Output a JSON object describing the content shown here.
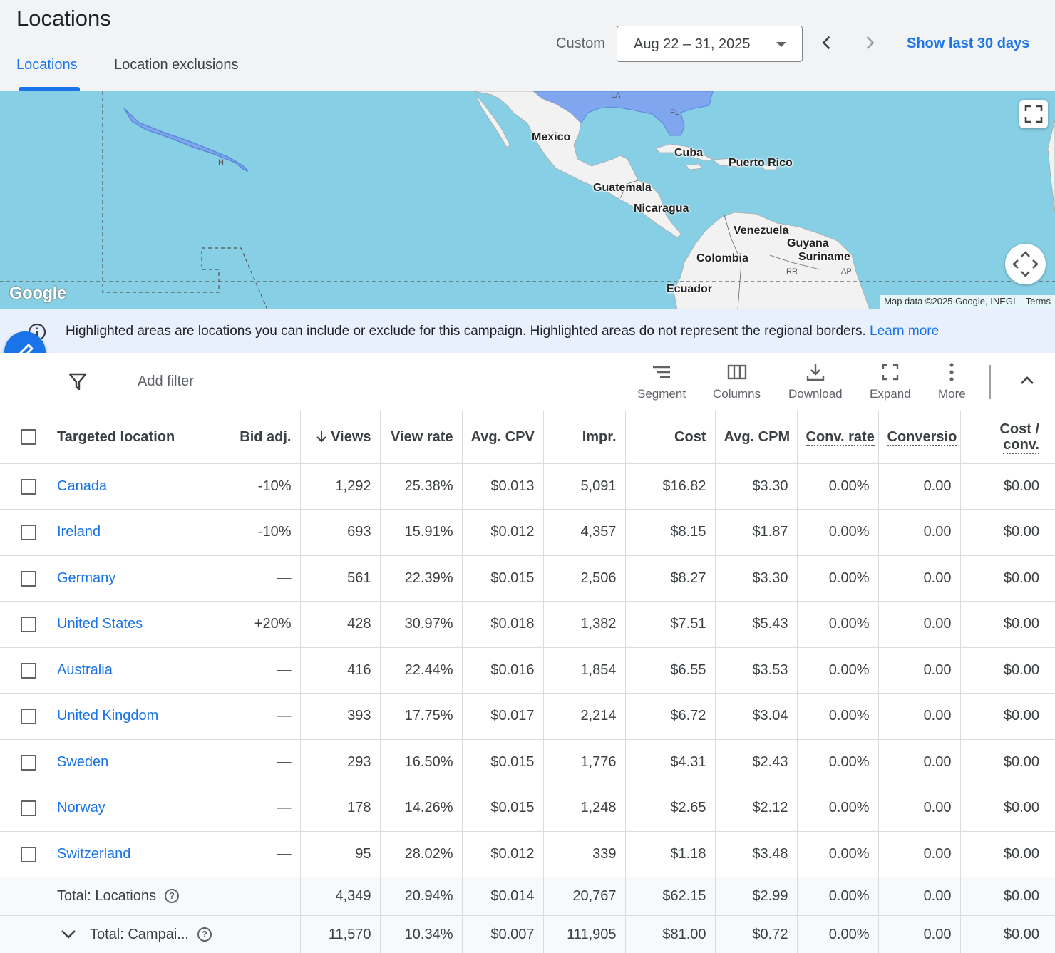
{
  "header": {
    "title": "Locations",
    "tabs": [
      {
        "label": "Locations"
      },
      {
        "label": "Location exclusions"
      }
    ],
    "custom_label": "Custom",
    "date_range": "Aug 22 – 31, 2025",
    "show_last": "Show last 30 days"
  },
  "map": {
    "labels": {
      "mexico": "Mexico",
      "cuba": "Cuba",
      "puerto_rico": "Puerto Rico",
      "guatemala": "Guatemala",
      "nicaragua": "Nicaragua",
      "venezuela": "Venezuela",
      "guyana": "Guyana",
      "suriname": "Suriname",
      "colombia": "Colombia",
      "ecuador": "Ecuador",
      "hi": "HI",
      "la": "LA",
      "fl": "FL",
      "rr": "RR",
      "ap": "AP"
    },
    "logo": "Google",
    "attribution": "Map data ©2025 Google, INEGI",
    "terms": "Terms"
  },
  "banner": {
    "text": "Highlighted areas are locations you can include or exclude for this campaign. Highlighted areas do not represent the regional borders.",
    "link": "Learn more"
  },
  "toolbar": {
    "add_filter": "Add filter",
    "segment": "Segment",
    "columns": "Columns",
    "download": "Download",
    "expand": "Expand",
    "more": "More"
  },
  "table": {
    "headers": {
      "location": "Targeted location",
      "bid_adj": "Bid adj.",
      "views": "Views",
      "view_rate": "View rate",
      "avg_cpv": "Avg. CPV",
      "impr": "Impr.",
      "cost": "Cost",
      "avg_cpm": "Avg. CPM",
      "conv_rate": "Conv. rate",
      "conversions": "Conversio",
      "cost_conv_1": "Cost /",
      "cost_conv_2": "conv."
    },
    "rows": [
      {
        "location": "Canada",
        "bid_adj": "-10%",
        "views": "1,292",
        "view_rate": "25.38%",
        "avg_cpv": "$0.013",
        "impr": "5,091",
        "cost": "$16.82",
        "avg_cpm": "$3.30",
        "conv_rate": "0.00%",
        "conversions": "0.00",
        "cost_conv": "$0.00"
      },
      {
        "location": "Ireland",
        "bid_adj": "-10%",
        "views": "693",
        "view_rate": "15.91%",
        "avg_cpv": "$0.012",
        "impr": "4,357",
        "cost": "$8.15",
        "avg_cpm": "$1.87",
        "conv_rate": "0.00%",
        "conversions": "0.00",
        "cost_conv": "$0.00"
      },
      {
        "location": "Germany",
        "bid_adj": "—",
        "views": "561",
        "view_rate": "22.39%",
        "avg_cpv": "$0.015",
        "impr": "2,506",
        "cost": "$8.27",
        "avg_cpm": "$3.30",
        "conv_rate": "0.00%",
        "conversions": "0.00",
        "cost_conv": "$0.00"
      },
      {
        "location": "United States",
        "bid_adj": "+20%",
        "views": "428",
        "view_rate": "30.97%",
        "avg_cpv": "$0.018",
        "impr": "1,382",
        "cost": "$7.51",
        "avg_cpm": "$5.43",
        "conv_rate": "0.00%",
        "conversions": "0.00",
        "cost_conv": "$0.00"
      },
      {
        "location": "Australia",
        "bid_adj": "—",
        "views": "416",
        "view_rate": "22.44%",
        "avg_cpv": "$0.016",
        "impr": "1,854",
        "cost": "$6.55",
        "avg_cpm": "$3.53",
        "conv_rate": "0.00%",
        "conversions": "0.00",
        "cost_conv": "$0.00"
      },
      {
        "location": "United Kingdom",
        "bid_adj": "—",
        "views": "393",
        "view_rate": "17.75%",
        "avg_cpv": "$0.017",
        "impr": "2,214",
        "cost": "$6.72",
        "avg_cpm": "$3.04",
        "conv_rate": "0.00%",
        "conversions": "0.00",
        "cost_conv": "$0.00"
      },
      {
        "location": "Sweden",
        "bid_adj": "—",
        "views": "293",
        "view_rate": "16.50%",
        "avg_cpv": "$0.015",
        "impr": "1,776",
        "cost": "$4.31",
        "avg_cpm": "$2.43",
        "conv_rate": "0.00%",
        "conversions": "0.00",
        "cost_conv": "$0.00"
      },
      {
        "location": "Norway",
        "bid_adj": "—",
        "views": "178",
        "view_rate": "14.26%",
        "avg_cpv": "$0.015",
        "impr": "1,248",
        "cost": "$2.65",
        "avg_cpm": "$2.12",
        "conv_rate": "0.00%",
        "conversions": "0.00",
        "cost_conv": "$0.00"
      },
      {
        "location": "Switzerland",
        "bid_adj": "—",
        "views": "95",
        "view_rate": "28.02%",
        "avg_cpv": "$0.012",
        "impr": "339",
        "cost": "$1.18",
        "avg_cpm": "$3.48",
        "conv_rate": "0.00%",
        "conversions": "0.00",
        "cost_conv": "$0.00"
      }
    ],
    "totals": [
      {
        "label": "Total: Locations",
        "bid_adj": "",
        "views": "4,349",
        "view_rate": "20.94%",
        "avg_cpv": "$0.014",
        "impr": "20,767",
        "cost": "$62.15",
        "avg_cpm": "$2.99",
        "conv_rate": "0.00%",
        "conversions": "0.00",
        "cost_conv": "$0.00"
      },
      {
        "label": "Total: Campai...",
        "bid_adj": "",
        "views": "11,570",
        "view_rate": "10.34%",
        "avg_cpv": "$0.007",
        "impr": "111,905",
        "cost": "$81.00",
        "avg_cpm": "$0.72",
        "conv_rate": "0.00%",
        "conversions": "0.00",
        "cost_conv": "$0.00"
      }
    ]
  },
  "colors": {
    "accent": "#1a73e8",
    "map_water": "#87cfe4",
    "map_land": "#f0f0f0",
    "map_highlight": "#7fa6ee",
    "banner_bg": "#e8f0fe"
  }
}
